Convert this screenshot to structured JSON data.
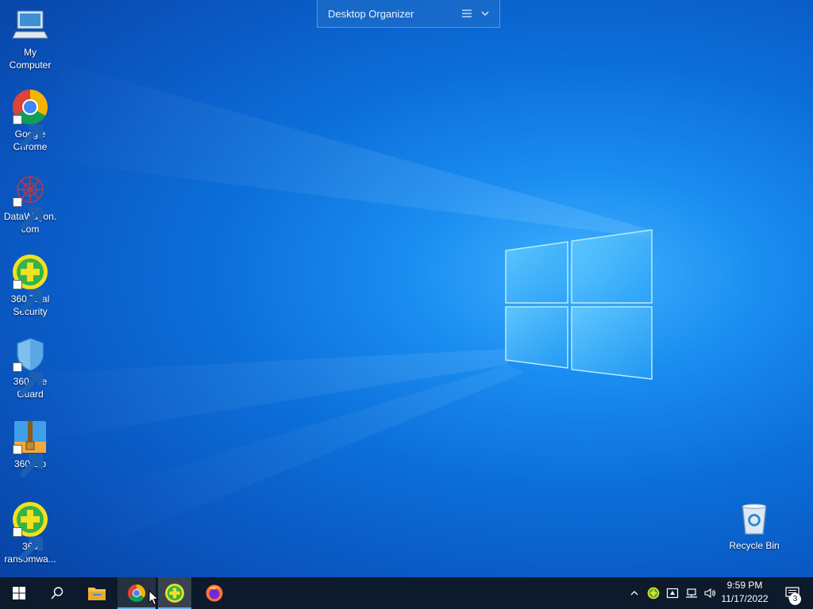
{
  "desktop": {
    "icons": [
      {
        "label": "My\nComputer",
        "icon": "computer-icon"
      },
      {
        "label": "Google\nChrome",
        "icon": "chrome-icon"
      },
      {
        "label": "DataWagon.\ncom",
        "icon": "datawagon-icon"
      },
      {
        "label": "360 Total\nSecurity",
        "icon": "360-total-security-icon"
      },
      {
        "label": "360 File\nGuard",
        "icon": "shield-icon"
      },
      {
        "label": "360 Zip",
        "icon": "zip-icon"
      },
      {
        "label": "360\nransomwa...",
        "icon": "360-ransomware-icon"
      },
      {
        "label": "Recycle Bin",
        "icon": "recycle-bin-icon"
      }
    ]
  },
  "organizer": {
    "title": "Desktop Organizer"
  },
  "taskbar": {
    "apps": [
      "start-icon",
      "search-icon",
      "file-explorer-icon",
      "chrome-icon",
      "360-total-security-icon",
      "firefox-icon"
    ],
    "tray": [
      "chevron-up-icon",
      "360-tray-icon",
      "security-tray-icon",
      "network-icon",
      "volume-icon"
    ],
    "time": "9:59 PM",
    "date": "11/17/2022",
    "notification_count": "3"
  }
}
